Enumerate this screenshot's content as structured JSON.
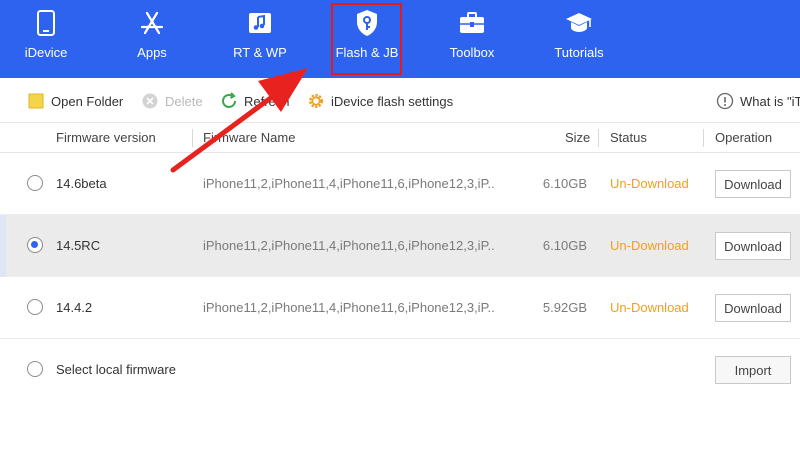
{
  "nav": {
    "items": [
      {
        "label": "iDevice",
        "icon": "phone-icon"
      },
      {
        "label": "Apps",
        "icon": "app-store-icon"
      },
      {
        "label": "RT & WP",
        "icon": "music-note-icon"
      },
      {
        "label": "Flash & JB",
        "icon": "shield-key-icon",
        "active": true
      },
      {
        "label": "Toolbox",
        "icon": "toolbox-icon"
      },
      {
        "label": "Tutorials",
        "icon": "graduation-cap-icon"
      }
    ],
    "background": "#2e63f0",
    "highlight_color": "#e21b1b"
  },
  "toolbar": {
    "open_folder": "Open Folder",
    "delete": "Delete",
    "refresh": "Refresh",
    "flash_settings": "iDevice flash settings",
    "help": "What is \"iT"
  },
  "table": {
    "headers": {
      "version": "Firmware version",
      "name": "Firmware Name",
      "size": "Size",
      "status": "Status",
      "operation": "Operation"
    },
    "rows": [
      {
        "version": "14.6beta",
        "name": "iPhone11,2,iPhone11,4,iPhone11,6,iPhone12,3,iP...",
        "size": "6.10GB",
        "status": "Un-Download",
        "action": "Download",
        "selected": false
      },
      {
        "version": "14.5RC",
        "name": "iPhone11,2,iPhone11,4,iPhone11,6,iPhone12,3,iP...",
        "size": "6.10GB",
        "status": "Un-Download",
        "action": "Download",
        "selected": true
      },
      {
        "version": "14.4.2",
        "name": "iPhone11,2,iPhone11,4,iPhone11,6,iPhone12,3,iP...",
        "size": "5.92GB",
        "status": "Un-Download",
        "action": "Download",
        "selected": false
      }
    ],
    "local": {
      "label": "Select local firmware",
      "action": "Import"
    },
    "status_color": "#f0a020"
  },
  "annotation": {
    "arrow_color": "#e8231f"
  }
}
